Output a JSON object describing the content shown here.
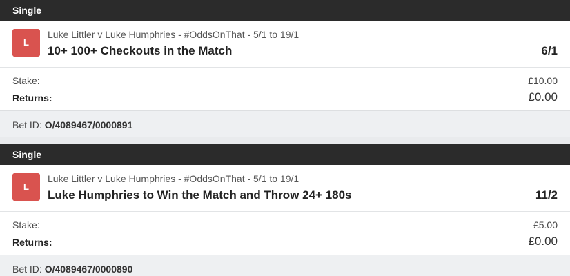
{
  "bets": [
    {
      "type": "Single",
      "badge": "L",
      "event": "Luke Littler v Luke Humphries - #OddsOnThat - 5/1 to 19/1",
      "market": "10+ 100+ Checkouts in the Match",
      "odds": "6/1",
      "stake_label": "Stake:",
      "stake": "£10.00",
      "returns_label": "Returns:",
      "returns": "£0.00",
      "betid_label": "Bet ID:",
      "betid": "O/4089467/0000891"
    },
    {
      "type": "Single",
      "badge": "L",
      "event": "Luke Littler v Luke Humphries - #OddsOnThat - 5/1 to 19/1",
      "market": "Luke Humphries to Win the Match and Throw 24+ 180s",
      "odds": "11/2",
      "stake_label": "Stake:",
      "stake": "£5.00",
      "returns_label": "Returns:",
      "returns": "£0.00",
      "betid_label": "Bet ID:",
      "betid": "O/4089467/0000890"
    }
  ],
  "colors": {
    "header_bg": "#2b2b2b",
    "badge_bg": "#d9534f",
    "betid_bg": "#eef0f2"
  }
}
